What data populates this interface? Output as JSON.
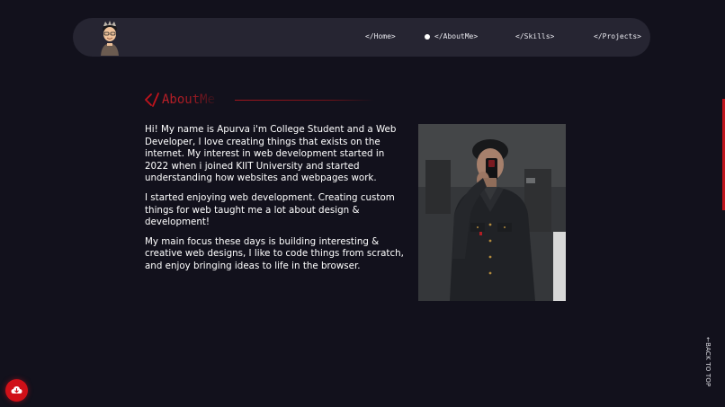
{
  "nav": {
    "links": [
      {
        "label": "</Home>"
      },
      {
        "label": "</AboutMe>"
      },
      {
        "label": "</Skills>"
      },
      {
        "label": "</Projects>"
      }
    ],
    "active_index": 1
  },
  "about": {
    "heading": "AboutMe",
    "paragraphs": [
      "Hi! My name is Apurva i'm College Student and a Web Developer, I love creating things that exists on the internet. My interest in web development started in 2022 when i joined KIIT University and started understanding how websites and webpages work.",
      "I started enjoying web development. Creating custom things for web taught me a lot about design & development!",
      "My main focus these days is building interesting & creative web designs, I like to code things from scratch, and enjoy bringing ideas to life in the browser."
    ]
  },
  "back_to_top": "←BACK TO TOP",
  "icons": {
    "avatar": "avatar-icon",
    "heading": "code-slash-icon",
    "fab": "cloud-download-icon"
  },
  "colors": {
    "background": "#12111c",
    "navbar": "#262532",
    "accent": "#c0141c"
  }
}
